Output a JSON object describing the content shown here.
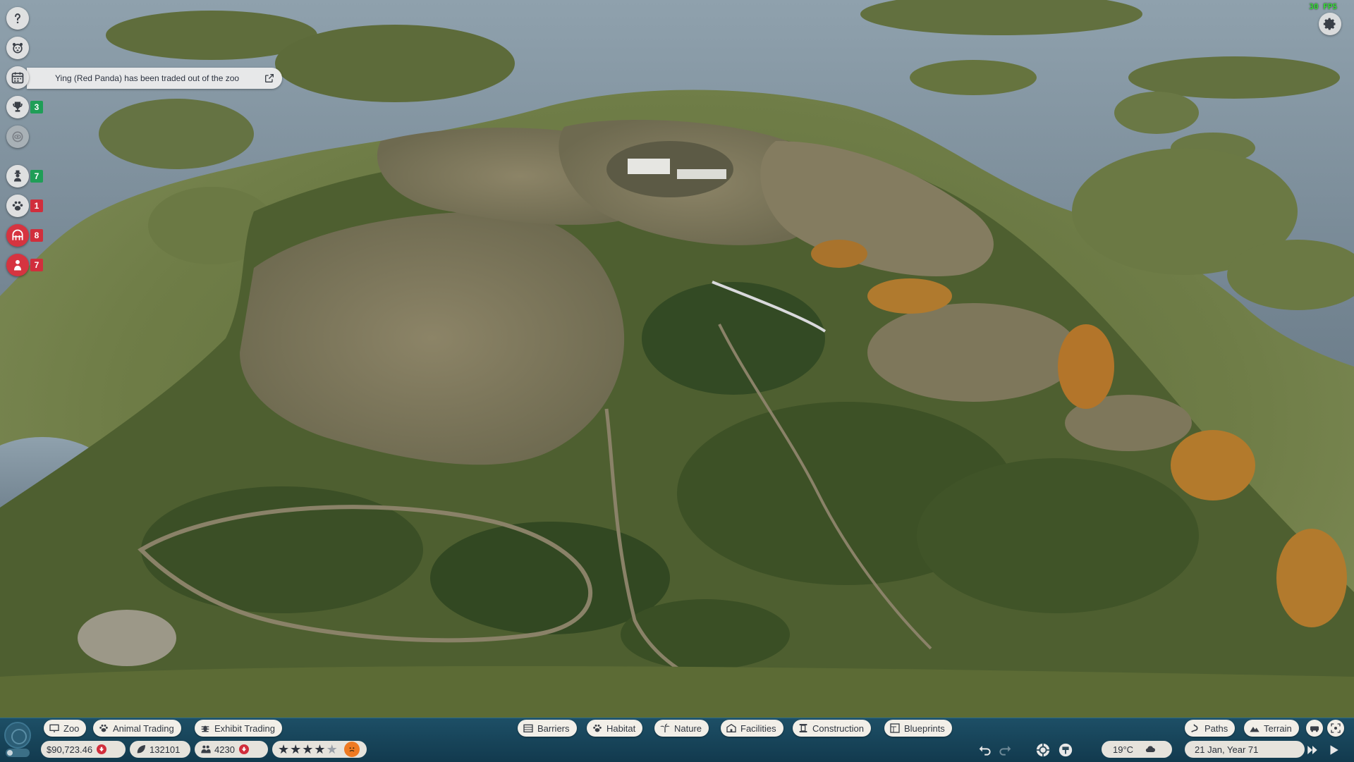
{
  "hud": {
    "fps": "30 FPS"
  },
  "left_rail": {
    "notification": "Ying (Red Panda) has been traded out of the zoo",
    "challenges_count": "3",
    "staff_count": "7",
    "animals_count": "1",
    "habitats_count": "8",
    "guests_count": "7"
  },
  "toolbar": {
    "left_tabs": [
      {
        "label": "Zoo",
        "icon": "zoo-icon"
      },
      {
        "label": "Animal Trading",
        "icon": "paw-icon"
      },
      {
        "label": "Exhibit Trading",
        "icon": "bug-icon"
      }
    ],
    "build_tabs": [
      {
        "label": "Barriers",
        "icon": "fence-icon"
      },
      {
        "label": "Habitat",
        "icon": "paw-icon"
      },
      {
        "label": "Nature",
        "icon": "palm-icon"
      },
      {
        "label": "Facilities",
        "icon": "building-icon"
      },
      {
        "label": "Construction",
        "icon": "pillar-icon"
      },
      {
        "label": "Blueprints",
        "icon": "blueprint-icon"
      }
    ],
    "right_tabs": [
      {
        "label": "Paths",
        "icon": "paths-icon"
      },
      {
        "label": "Terrain",
        "icon": "terrain-icon"
      }
    ]
  },
  "status": {
    "money": "$90,723.46",
    "conservation_credits": "132101",
    "guests": "4230",
    "zoo_rating_stars": 4,
    "zoo_rating_max": 5,
    "temperature": "19°C",
    "weather_icon": "cloud-icon",
    "date": "21 Jan, Year 71"
  },
  "colors": {
    "toolbar_bg": "#1d4f66",
    "alert_red": "#d12e3c",
    "positive_green": "#1f9e57",
    "guest_mood": "#ee7a22"
  }
}
